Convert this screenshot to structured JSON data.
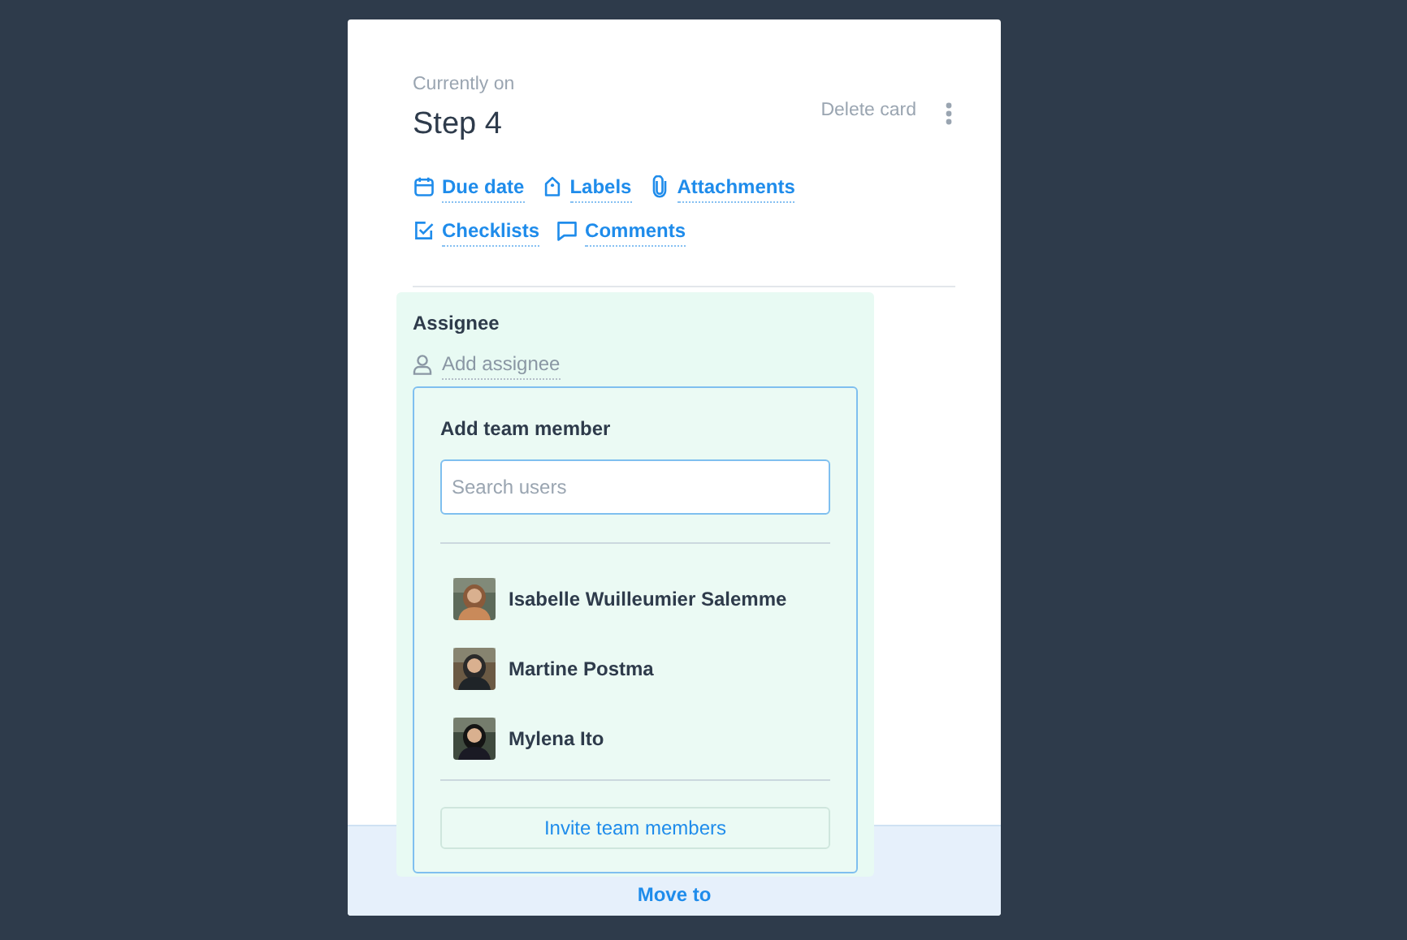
{
  "card": {
    "caption": "Currently on",
    "title": "Step 4",
    "delete_label": "Delete card"
  },
  "actions": [
    {
      "kind": "calendar",
      "label": "Due date"
    },
    {
      "kind": "tag",
      "label": "Labels"
    },
    {
      "kind": "clip",
      "label": "Attachments"
    },
    {
      "kind": "check",
      "label": "Checklists"
    },
    {
      "kind": "comment",
      "label": "Comments"
    }
  ],
  "assignee": {
    "heading": "Assignee",
    "add_label": "Add assignee"
  },
  "popover": {
    "title": "Add team member",
    "search": {
      "placeholder": "Search users"
    },
    "members": [
      {
        "name": "Isabelle Wuilleumier Salemme"
      },
      {
        "name": "Martine Postma"
      },
      {
        "name": "Mylena Ito"
      }
    ],
    "invite_button": "Invite team members"
  },
  "footer": {
    "move_label": "Move to"
  }
}
